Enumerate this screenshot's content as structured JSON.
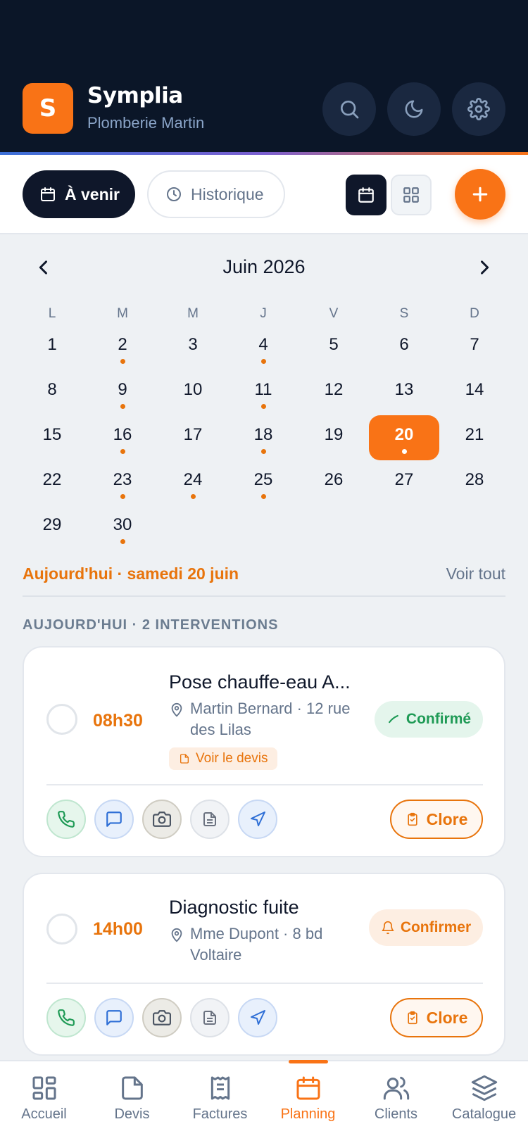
{
  "header": {
    "logo_letter": "S",
    "app_name": "Symplia",
    "company": "Plomberie Martin"
  },
  "toolbar": {
    "tab_upcoming": "À venir",
    "tab_history": "Historique"
  },
  "calendar": {
    "month_label": "Juin 2026",
    "weekdays": [
      "L",
      "M",
      "M",
      "J",
      "V",
      "S",
      "D"
    ],
    "days": [
      {
        "d": "1",
        "dot": false
      },
      {
        "d": "2",
        "dot": true
      },
      {
        "d": "3",
        "dot": false
      },
      {
        "d": "4",
        "dot": true
      },
      {
        "d": "5",
        "dot": false
      },
      {
        "d": "6",
        "dot": false
      },
      {
        "d": "7",
        "dot": false
      },
      {
        "d": "8",
        "dot": false
      },
      {
        "d": "9",
        "dot": true
      },
      {
        "d": "10",
        "dot": false
      },
      {
        "d": "11",
        "dot": true
      },
      {
        "d": "12",
        "dot": false
      },
      {
        "d": "13",
        "dot": false
      },
      {
        "d": "14",
        "dot": false
      },
      {
        "d": "15",
        "dot": false
      },
      {
        "d": "16",
        "dot": true
      },
      {
        "d": "17",
        "dot": false
      },
      {
        "d": "18",
        "dot": true
      },
      {
        "d": "19",
        "dot": false
      },
      {
        "d": "20",
        "dot": true,
        "today": true
      },
      {
        "d": "21",
        "dot": false
      },
      {
        "d": "22",
        "dot": false
      },
      {
        "d": "23",
        "dot": true
      },
      {
        "d": "24",
        "dot": true
      },
      {
        "d": "25",
        "dot": true
      },
      {
        "d": "26",
        "dot": false
      },
      {
        "d": "27",
        "dot": false
      },
      {
        "d": "28",
        "dot": false
      },
      {
        "d": "29",
        "dot": false
      },
      {
        "d": "30",
        "dot": true
      }
    ]
  },
  "today": {
    "label": "Aujourd'hui · samedi 20 juin",
    "see_all": "Voir tout",
    "section_title": "AUJOURD'HUI · 2 INTERVENTIONS"
  },
  "interventions": [
    {
      "time": "08h30",
      "title": "Pose chauffe-eau A...",
      "meta": "Martin Bernard · 12 rue des Lilas",
      "quote_link": "Voir le devis",
      "status": "Confirmé",
      "close_label": "Clore"
    },
    {
      "time": "14h00",
      "title": "Diagnostic fuite",
      "meta": "Mme Dupont · 8 bd Voltaire",
      "status": "Confirmer",
      "close_label": "Clore"
    }
  ],
  "nav": {
    "items": [
      "Accueil",
      "Devis",
      "Factures",
      "Planning",
      "Clients",
      "Catalogue"
    ],
    "active": "Planning"
  },
  "colors": {
    "accent": "#f97316",
    "header_bg": "#0b1628",
    "success": "#1e9a55"
  }
}
